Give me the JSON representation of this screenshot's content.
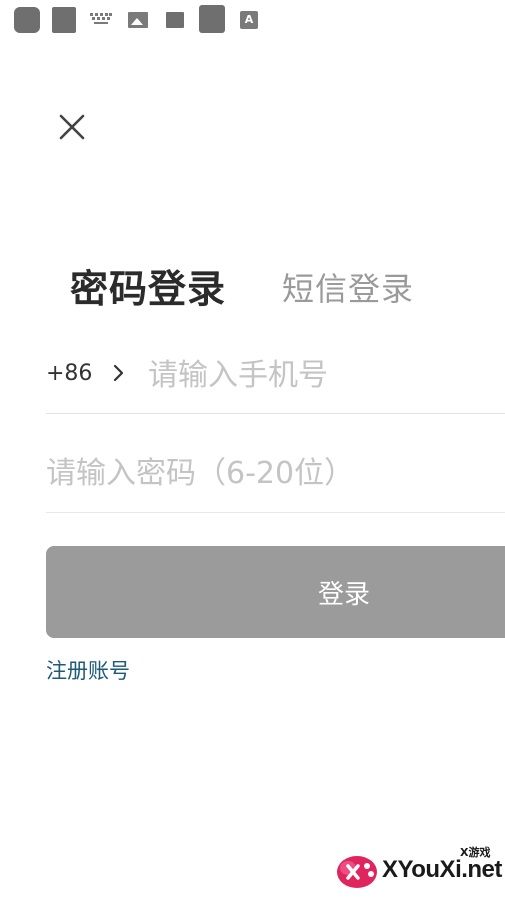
{
  "status_bar": {
    "icons": [
      "app-icon",
      "app-icon",
      "keyboard-icon",
      "image-icon",
      "square-icon",
      "app-icon",
      "text-icon"
    ]
  },
  "close": {
    "icon": "close-icon"
  },
  "tabs": [
    {
      "label": "密码登录",
      "active": true
    },
    {
      "label": "短信登录",
      "active": false
    }
  ],
  "phone": {
    "country_code": "+86",
    "placeholder": "请输入手机号"
  },
  "password": {
    "placeholder": "请输入密码（6-20位）"
  },
  "login_button": {
    "label": "登录"
  },
  "register_link": {
    "label": "注册账号"
  },
  "watermark": {
    "text": "XYouXi.net",
    "small_text": "X游戏"
  },
  "colors": {
    "button_bg": "#9b9b9b",
    "link": "#1c5a78",
    "active_tab": "#2b2b2b",
    "inactive_tab": "#9a9a9a",
    "placeholder": "#c4c4c4"
  }
}
